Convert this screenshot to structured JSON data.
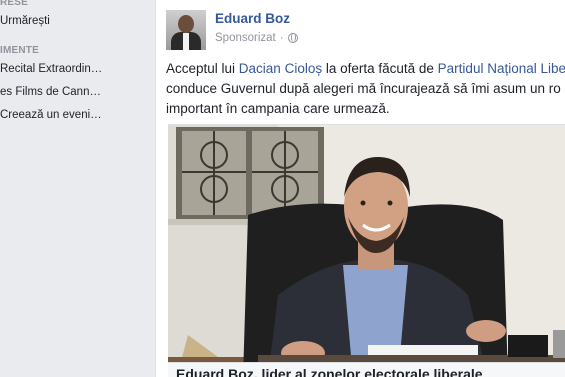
{
  "sidebar": {
    "sections": [
      {
        "header": "RESE",
        "items": [
          {
            "label": "Urmărești"
          }
        ]
      },
      {
        "header": "IMENTE",
        "items": [
          {
            "label": "Recital Extraordin…"
          },
          {
            "label": "es Films de Cann…"
          },
          {
            "label": "Creează un eveni…"
          }
        ]
      }
    ]
  },
  "post": {
    "author": "Eduard Boz",
    "sponsored_label": "Sponsorizat",
    "separator": "·",
    "text": {
      "line1_before": "Acceptul lui ",
      "line1_link1": "Dacian Cioloș",
      "line1_middle": " la oferta făcută de ",
      "line1_link2": "Partidul Național Liber",
      "line2": "conduce Guvernul după alegeri mă încurajează să îmi asum un ro",
      "line3": "important în campania care urmează."
    },
    "caption": "Eduard Boz, lider al zonelor electorale liberale"
  },
  "colors": {
    "link": "#365899",
    "meta": "#90949c",
    "background": "#e9ebee",
    "card": "#ffffff"
  }
}
